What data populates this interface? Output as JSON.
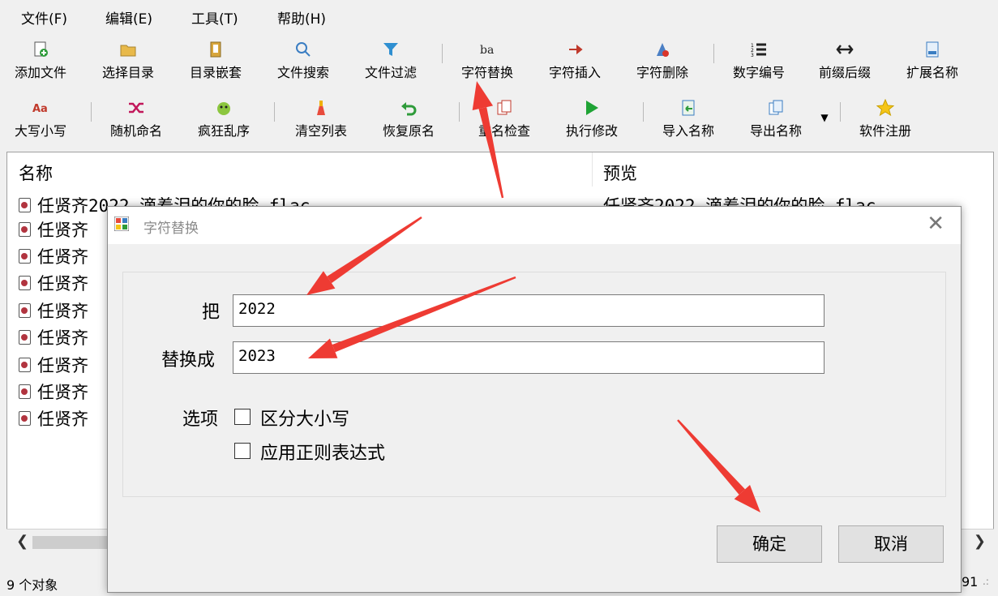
{
  "menu": [
    "文件(F)",
    "编辑(E)",
    "工具(T)",
    "帮助(H)"
  ],
  "toolbar_row1": [
    {
      "label": "添加文件",
      "icon": "add-file-icon"
    },
    {
      "label": "选择目录",
      "icon": "folder-icon"
    },
    {
      "label": "目录嵌套",
      "icon": "nested-folder-icon"
    },
    {
      "label": "文件搜索",
      "icon": "search-icon"
    },
    {
      "label": "文件过滤",
      "icon": "filter-icon"
    },
    {
      "label": "字符替换",
      "icon": "replace-icon"
    },
    {
      "label": "字符插入",
      "icon": "insert-icon"
    },
    {
      "label": "字符删除",
      "icon": "delete-char-icon"
    },
    {
      "label": "数字编号",
      "icon": "numbering-icon"
    },
    {
      "label": "前缀后缀",
      "icon": "prefix-suffix-icon"
    },
    {
      "label": "扩展名称",
      "icon": "extension-icon"
    }
  ],
  "toolbar_row2": [
    {
      "label": "大写小写",
      "icon": "case-icon"
    },
    {
      "label": "随机命名",
      "icon": "shuffle-icon"
    },
    {
      "label": "疯狂乱序",
      "icon": "crazy-icon"
    },
    {
      "label": "清空列表",
      "icon": "clear-icon"
    },
    {
      "label": "恢复原名",
      "icon": "undo-icon"
    },
    {
      "label": "重名检查",
      "icon": "duplicate-check-icon"
    },
    {
      "label": "执行修改",
      "icon": "run-icon"
    },
    {
      "label": "导入名称",
      "icon": "import-icon"
    },
    {
      "label": "导出名称",
      "icon": "export-icon"
    },
    {
      "label": "软件注册",
      "icon": "star-icon"
    }
  ],
  "list": {
    "col_name": "名称",
    "col_preview": "预览",
    "first_row_name": "任贤齐2022-滴着泪的你的脸.flac",
    "first_row_preview": "任贤齐2022-滴着泪的你的脸.flac",
    "row_prefix": "任贤齐",
    "row_count": 9
  },
  "status": {
    "count": "9 个对象",
    "right_fragment": "91"
  },
  "dialog": {
    "title": "字符替换",
    "from_label": "把",
    "from_value": "2022",
    "to_label": "替换成",
    "to_value": "2023",
    "options_label": "选项",
    "option_case": "区分大小写",
    "option_regex": "应用正则表达式",
    "ok": "确定",
    "cancel": "取消"
  },
  "colors": {
    "arrow": "#ee3b33"
  }
}
